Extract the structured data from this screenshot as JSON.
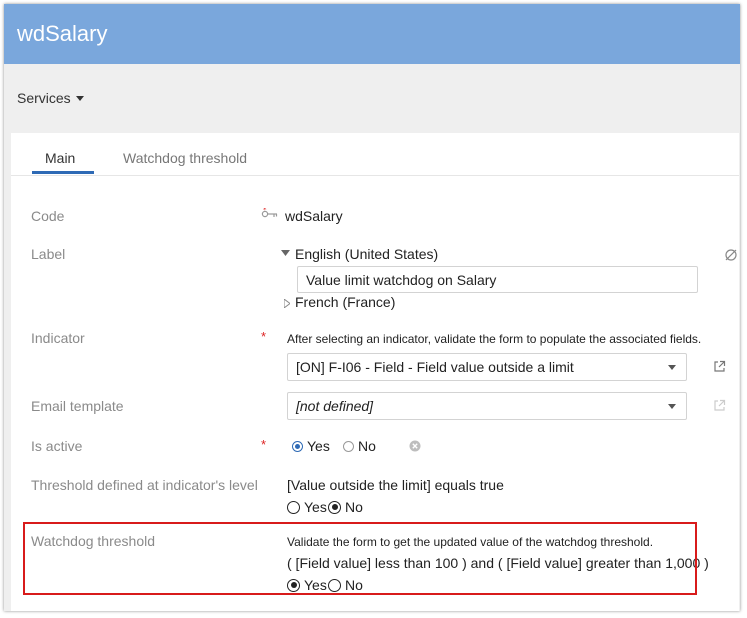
{
  "app": {
    "title": "wdSalary"
  },
  "menu": {
    "services_label": "Services"
  },
  "tabs": [
    {
      "label": "Main",
      "active": true
    },
    {
      "label": "Watchdog threshold",
      "active": false
    }
  ],
  "form": {
    "code": {
      "label": "Code",
      "value": "wdSalary"
    },
    "label": {
      "label": "Label",
      "lang_en": "English (United States)",
      "value_en": "Value limit watchdog on Salary",
      "lang_fr": "French (France)"
    },
    "indicator": {
      "label": "Indicator",
      "hint": "After selecting an indicator, validate the form to populate the associated fields.",
      "value": "[ON] F-I06 - Field - Field value outside a limit"
    },
    "email_template": {
      "label": "Email template",
      "value": "[not defined]"
    },
    "is_active": {
      "label": "Is active",
      "yes": "Yes",
      "no": "No"
    },
    "threshold_indicator": {
      "label": "Threshold defined at indicator's level",
      "expression": "[Value outside the limit] equals true",
      "yes": "Yes",
      "no": "No"
    },
    "watchdog_threshold": {
      "label": "Watchdog threshold",
      "hint": "Validate the form to get the updated value of the watchdog threshold.",
      "expression": "( [Field value] less than 100 ) and ( [Field value] greater than 1,000 )",
      "yes": "Yes",
      "no": "No"
    }
  },
  "colors": {
    "header": "#7aa7dc",
    "tab_underline": "#2e6ab5",
    "required": "#dd2222",
    "highlight_border": "#d81b1b"
  }
}
